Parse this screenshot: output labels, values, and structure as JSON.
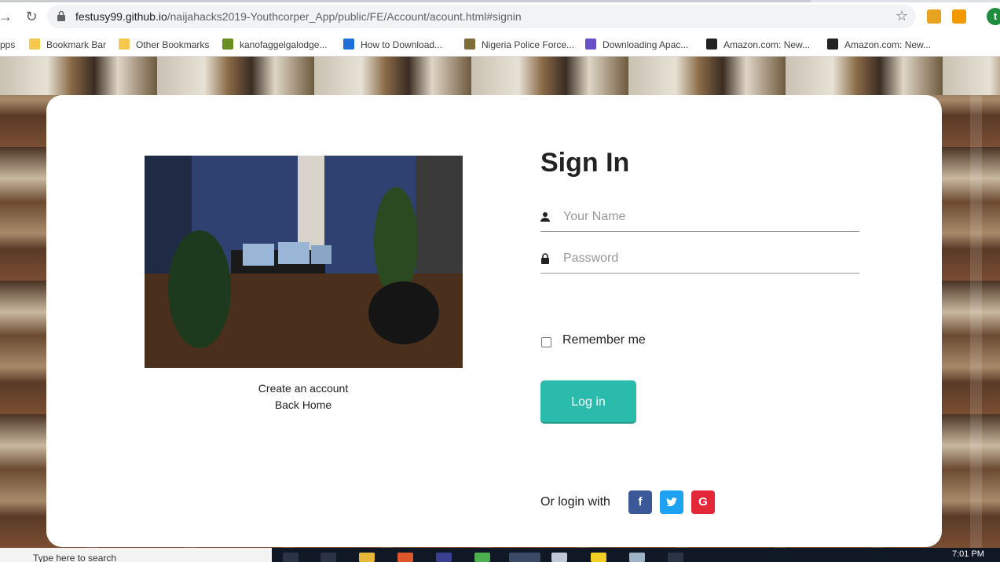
{
  "browser": {
    "url_host": "festusy99.github.io",
    "url_path": "/naijahacks2019-Youthcorper_App/public/FE/Account/acount.html#signin",
    "bookmarks": [
      "pps",
      "Bookmark Bar",
      "Other Bookmarks",
      "kanofaggelgalodge...",
      "How to Download...",
      "Nigeria Police Force...",
      "Downloading Apac...",
      "Amazon.com: New...",
      "Amazon.com: New..."
    ],
    "profile_initial": "t"
  },
  "page": {
    "links": {
      "create_account": "Create an account",
      "back_home": "Back Home"
    },
    "signin": {
      "title": "Sign In",
      "name_placeholder": "Your Name",
      "password_placeholder": "Password",
      "remember_label": "Remember me",
      "login_button": "Log in",
      "social_label": "Or login with",
      "facebook": "f",
      "twitter": "t",
      "google": "G"
    },
    "colors": {
      "login_button": "#2bbbad",
      "facebook": "#3b5998",
      "twitter": "#1da1f2",
      "google": "#e4283a"
    }
  },
  "taskbar": {
    "search_text": "Type here to search",
    "time": "7:01 PM"
  }
}
